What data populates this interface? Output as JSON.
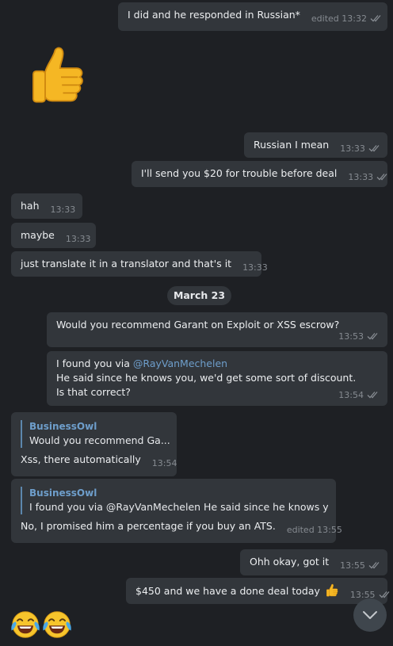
{
  "messages": {
    "m1": {
      "text": "I did and he responded in Russian*",
      "time": "edited 13:32"
    },
    "m3": {
      "text": "Russian I mean",
      "time": "13:33"
    },
    "m4": {
      "text": "I'll send you $20 for trouble before deal",
      "time": "13:33"
    },
    "m5": {
      "text": "hah",
      "time": "13:33"
    },
    "m6": {
      "text": "maybe",
      "time": "13:33"
    },
    "m7": {
      "text": "just translate it in a translator and that's it",
      "time": "13:33"
    },
    "m8": {
      "text": "Would you recommend Garant on Exploit or XSS escrow?",
      "time": "13:53"
    },
    "m9": {
      "text_line1": "I found you via ",
      "mention": "@RayVanMechelen",
      "text_rest": "He said since he knows you, we'd get some sort of discount. Is that correct?",
      "time": "13:54"
    },
    "m10": {
      "reply_name": "BusinessOwl",
      "reply_text": "Would you recommend Ga...",
      "text": "Xss, there automatically",
      "time": "13:54"
    },
    "m11": {
      "reply_name": "BusinessOwl",
      "reply_text": "I found you via @RayVanMechelen He said since he knows yo...",
      "text": "No, I promised him a percentage if you buy an ATS.",
      "time": "edited 13:55"
    },
    "m12": {
      "text": "Ohh okay, got it",
      "time": "13:55"
    },
    "m13": {
      "text": "$450 and we have a done deal today",
      "time": "13:55"
    }
  },
  "date_separator": "March 23",
  "colors": {
    "background": "#1e2024",
    "bubble": "#32363b",
    "meta": "#868b91",
    "reply_accent": "#6e9ecb",
    "mention": "#6e9ecb"
  },
  "icons": {
    "thumbs_up": "thumbs-up-emoji",
    "laughing": "face-with-tears-of-joy-emoji",
    "read_ticks": "double-check-icon",
    "scroll_down": "chevron-down-icon"
  }
}
